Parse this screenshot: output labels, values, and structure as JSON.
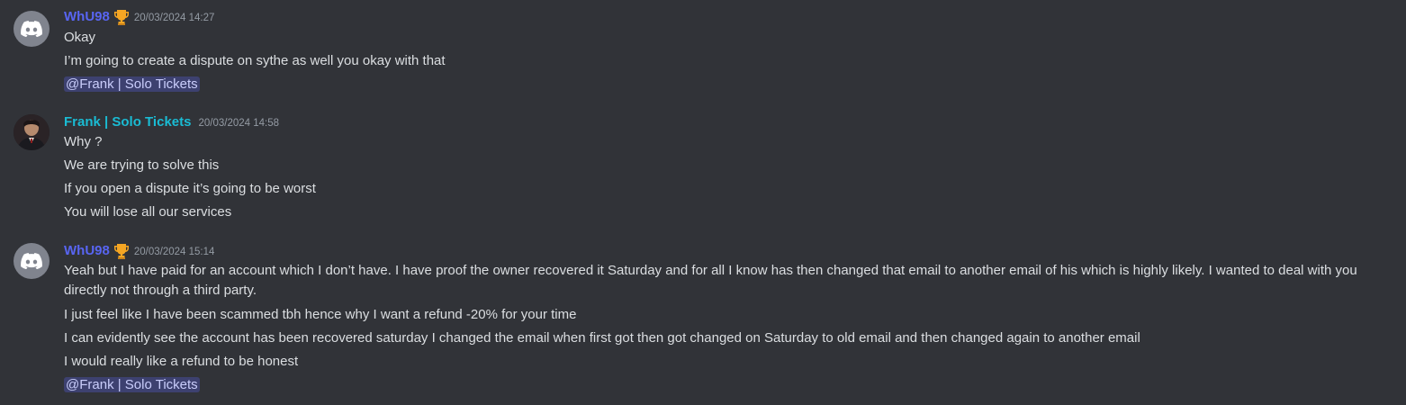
{
  "messages": [
    {
      "username": "WhU98",
      "username_color": "#5865f2",
      "timestamp": "20/03/2024 14:27",
      "avatar_icon": "discord-logo-icon",
      "has_badge": true,
      "badge_icon": "trophy-icon",
      "lines": [
        "Okay",
        "I’m going to create a dispute on sythe as well you okay with that"
      ],
      "mention": "@Frank | Solo Tickets"
    },
    {
      "username": "Frank | Solo Tickets",
      "username_color": "#1abcd4",
      "timestamp": "20/03/2024 14:58",
      "avatar_icon": "user-photo-avatar",
      "has_badge": false,
      "lines": [
        "Why ?",
        "We are trying to solve this",
        "If you open a dispute it’s going to be worst",
        "You will lose all our services"
      ]
    },
    {
      "username": "WhU98",
      "username_color": "#5865f2",
      "timestamp": "20/03/2024 15:14",
      "avatar_icon": "discord-logo-icon",
      "has_badge": true,
      "badge_icon": "trophy-icon",
      "lines": [
        "Yeah but I have paid for an account which I don’t have. I have proof the owner recovered it Saturday and for all I know has then changed that email to another email of his which is highly likely. I wanted to deal with you directly not through a third party.",
        "I just feel like I have been scammed tbh hence why I want a refund -20% for your time",
        "I can evidently see the account has been recovered saturday I changed the email when first got then got changed on Saturday to old email and then changed again to another email",
        "I would really like a refund to be honest"
      ],
      "mention": "@Frank | Solo Tickets"
    }
  ],
  "colors": {
    "background": "#313338",
    "text": "#dbdee1",
    "timestamp": "#949ba4",
    "mention_bg": "#3c4270",
    "mention_text": "#c9cdfb"
  }
}
